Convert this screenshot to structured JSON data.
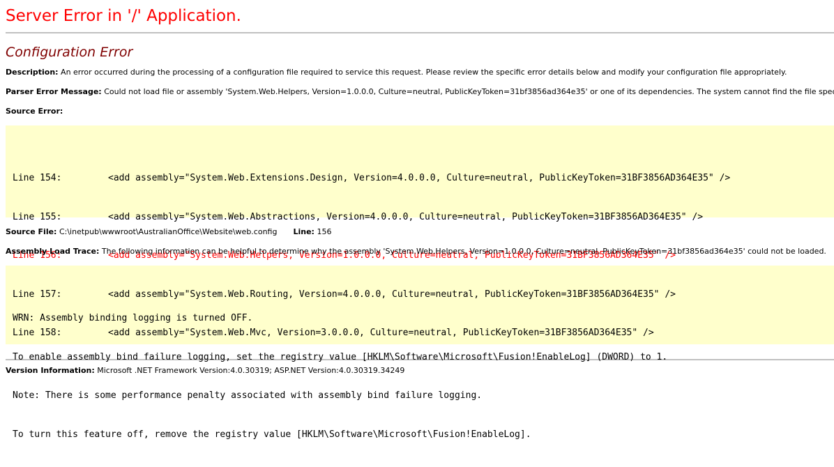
{
  "header": {
    "title": "Server Error in '/' Application."
  },
  "error": {
    "heading": "Configuration Error",
    "description_label": "Description:",
    "description_text": "An error occurred during the processing of a configuration file required to service this request. Please review the specific error details below and modify your configuration file appropriately.",
    "parser_label": "Parser Error Message:",
    "parser_text": "Could not load file or assembly 'System.Web.Helpers, Version=1.0.0.0, Culture=neutral, PublicKeyToken=31bf3856ad364e35' or one of its dependencies. The system cannot find the file specified.",
    "source_error_label": "Source Error:"
  },
  "source_lines": [
    {
      "num": "Line 154:",
      "code": "<add assembly=\"System.Web.Extensions.Design, Version=4.0.0.0, Culture=neutral, PublicKeyToken=31BF3856AD364E35\" />",
      "highlight": false
    },
    {
      "num": "Line 155:",
      "code": "<add assembly=\"System.Web.Abstractions, Version=4.0.0.0, Culture=neutral, PublicKeyToken=31BF3856AD364E35\" />",
      "highlight": false
    },
    {
      "num": "Line 156:",
      "code": "<add assembly=\"System.Web.Helpers, Version=1.0.0.0, Culture=neutral, PublicKeyToken=31BF3856AD364E35\" />",
      "highlight": true
    },
    {
      "num": "Line 157:",
      "code": "<add assembly=\"System.Web.Routing, Version=4.0.0.0, Culture=neutral, PublicKeyToken=31BF3856AD364E35\" />",
      "highlight": false
    },
    {
      "num": "Line 158:",
      "code": "<add assembly=\"System.Web.Mvc, Version=3.0.0.0, Culture=neutral, PublicKeyToken=31BF3856AD364E35\" />",
      "highlight": false
    }
  ],
  "source_file": {
    "label": "Source File:",
    "path": "C:\\inetpub\\wwwroot\\AustralianOffice\\Website\\web.config",
    "line_label": "Line:",
    "line_value": "156"
  },
  "trace": {
    "label": "Assembly Load Trace:",
    "text": "The following information can be helpful to determine why the assembly 'System.Web.Helpers, Version=1.0.0.0, Culture=neutral, PublicKeyToken=31bf3856ad364e35' could not be loaded.",
    "lines": [
      "WRN: Assembly binding logging is turned OFF.",
      "To enable assembly bind failure logging, set the registry value [HKLM\\Software\\Microsoft\\Fusion!EnableLog] (DWORD) to 1.",
      "Note: There is some performance penalty associated with assembly bind failure logging.",
      "To turn this feature off, remove the registry value [HKLM\\Software\\Microsoft\\Fusion!EnableLog]."
    ]
  },
  "version": {
    "label": "Version Information:",
    "text": "Microsoft .NET Framework Version:4.0.30319; ASP.NET Version:4.0.30319.34249"
  },
  "colors": {
    "title": "#ff0000",
    "heading": "#800000",
    "code_background": "#ffffcc",
    "error_line": "#ff0000",
    "rule": "#c0c0c0"
  }
}
